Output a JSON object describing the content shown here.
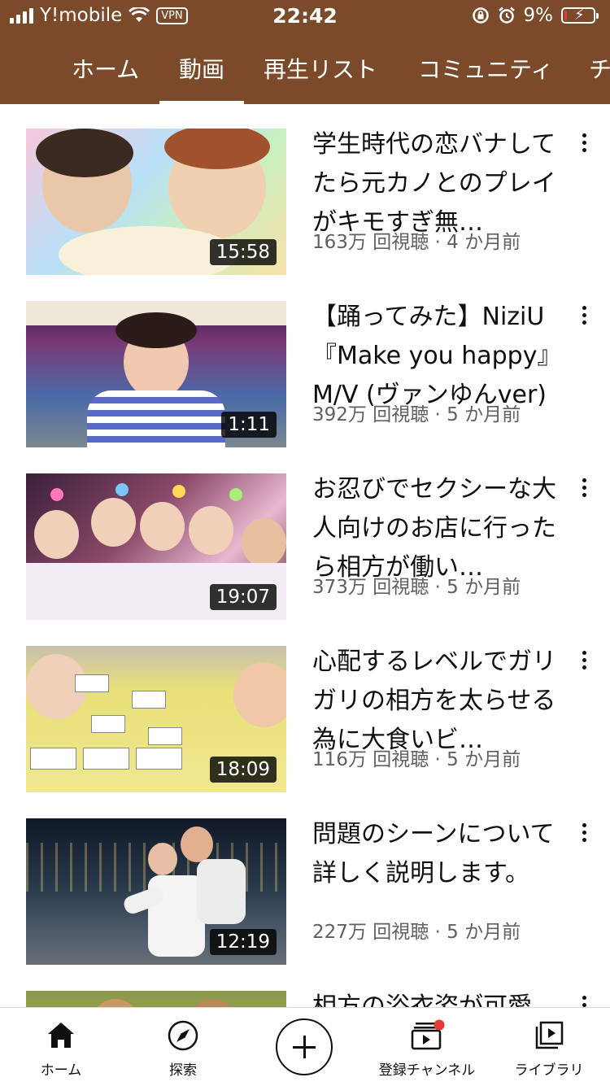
{
  "status_bar": {
    "carrier": "Y!mobile",
    "vpn": "VPN",
    "time": "22:42",
    "battery": "9%",
    "battery_level": 0.09
  },
  "tabs": [
    {
      "label": "ホーム"
    },
    {
      "label": "動画",
      "active": true
    },
    {
      "label": "再生リスト"
    },
    {
      "label": "コミュニティ"
    },
    {
      "label": "チ"
    }
  ],
  "videos": [
    {
      "title": "学生時代の恋バナしてたら元カノとのプレイがキモすぎ無…",
      "meta": "163万 回視聴 · 4 か月前",
      "duration": "15:58"
    },
    {
      "title": "【踊ってみた】NiziU『Make you happy』M/V (ヴァンゆんver)",
      "meta": "392万 回視聴 · 5 か月前",
      "duration": "1:11"
    },
    {
      "title": "お忍びでセクシーな大人向けのお店に行ったら相方が働い…",
      "meta": "373万 回視聴 · 5 か月前",
      "duration": "19:07"
    },
    {
      "title": "心配するレベルでガリガリの相方を太らせる為に大食いビ…",
      "meta": "116万 回視聴 · 5 か月前",
      "duration": "18:09"
    },
    {
      "title": "問題のシーンについて詳しく説明します。",
      "meta": "227万 回視聴 · 5 か月前",
      "duration": "12:19"
    },
    {
      "title": "相方の浴衣姿が可愛",
      "meta": "",
      "duration": ""
    }
  ],
  "bottom_nav": {
    "home": "ホーム",
    "explore": "探索",
    "subscriptions": "登録チャンネル",
    "library": "ライブラリ"
  },
  "colors": {
    "header_bg": "#7a4a2b",
    "notification_dot": "#e53935"
  }
}
